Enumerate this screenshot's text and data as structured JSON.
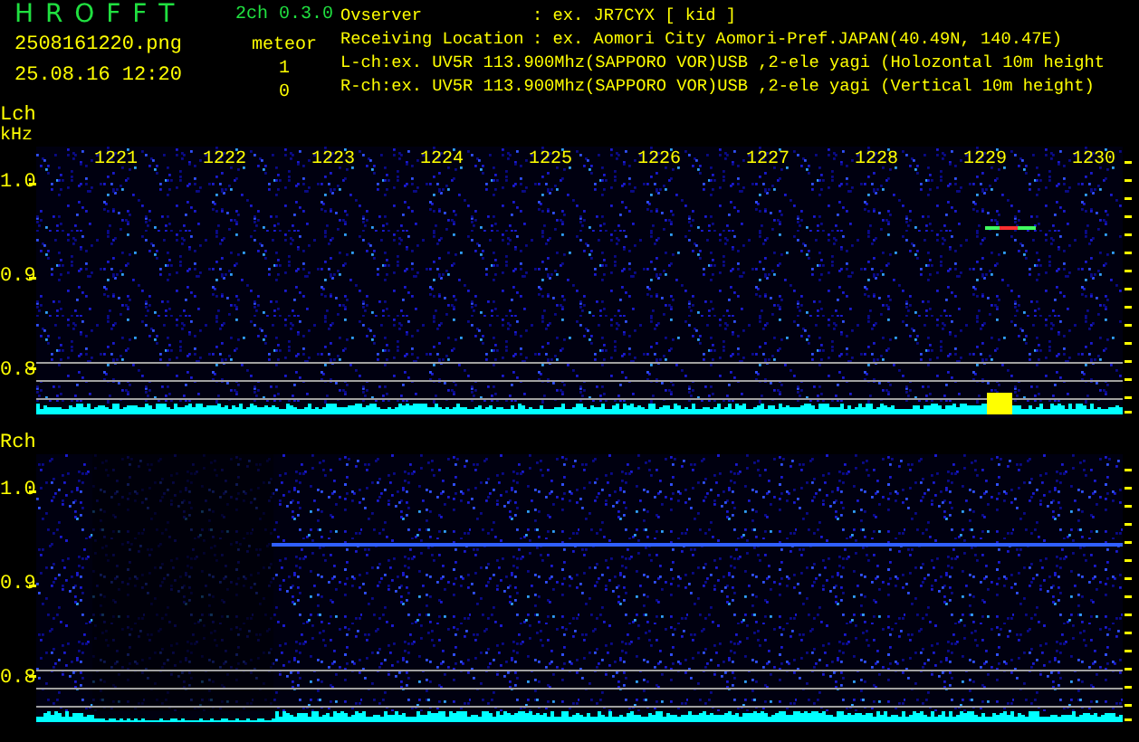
{
  "header": {
    "app_name": "H R O F F T",
    "version": "2ch 0.3.0",
    "file_name": "2508161220.png",
    "datetime": "25.08.16 12:20",
    "mode": "meteor",
    "counts": [
      "1",
      "0"
    ],
    "info": [
      {
        "key": "Ovserver",
        "value": ": ex. JR7CYX [ kid ]"
      },
      {
        "key": "Receiving Location",
        "value": ": ex. Aomori City Aomori-Pref.JAPAN(40.49N, 140.47E)"
      }
    ],
    "channel_lines": [
      "L-ch:ex. UV5R 113.900Mhz(SAPPORO VOR)USB ,2-ele yagi (Holozontal 10m height",
      "R-ch:ex. UV5R 113.900Mhz(SAPPORO VOR)USB ,2-ele yagi (Vertical 10m height)"
    ]
  },
  "channels": [
    {
      "label": "Lch",
      "unit": "kHz",
      "yticks": [
        "1.0",
        "0.9",
        "0.8"
      ],
      "xticks": [
        "1221",
        "1222",
        "1223",
        "1224",
        "1225",
        "1226",
        "1227",
        "1228",
        "1229",
        "1230"
      ]
    },
    {
      "label": "Rch",
      "yticks": [
        "1.0",
        "0.9",
        "0.8"
      ]
    }
  ]
}
